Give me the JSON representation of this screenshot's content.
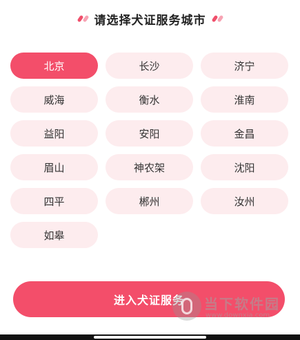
{
  "header": {
    "title": "请选择犬证服务城市"
  },
  "cities": [
    {
      "label": "北京",
      "selected": true
    },
    {
      "label": "长沙"
    },
    {
      "label": "济宁"
    },
    {
      "label": "威海"
    },
    {
      "label": "衡水"
    },
    {
      "label": "淮南"
    },
    {
      "label": "益阳"
    },
    {
      "label": "安阳"
    },
    {
      "label": "金昌"
    },
    {
      "label": "眉山"
    },
    {
      "label": "神农架"
    },
    {
      "label": "沈阳"
    },
    {
      "label": "四平"
    },
    {
      "label": "郴州"
    },
    {
      "label": "汝州"
    },
    {
      "label": "如皋"
    }
  ],
  "footer": {
    "enter_label": "进入犬证服务"
  },
  "watermark": {
    "name": "当下软件园",
    "url": "www.downxia.com"
  },
  "colors": {
    "accent": "#f34e6a",
    "pill_bg": "#fdecee",
    "text": "#333333"
  }
}
